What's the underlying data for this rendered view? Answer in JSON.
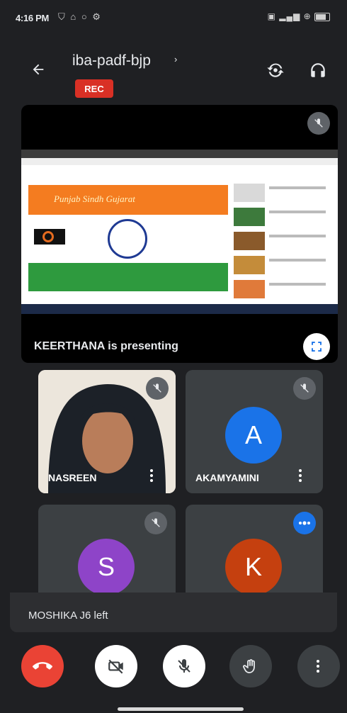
{
  "status_bar": {
    "time": "4:16 PM",
    "left_icons": "⛉ ⌂ ○ ⚙",
    "right_icons": "▣ ▂▄▆ ⊕"
  },
  "header": {
    "meeting_code": "iba-padf-bjp",
    "chevron": "›",
    "rec_badge": "REC"
  },
  "presentation": {
    "presenter_label": "KEERTHANA is presenting",
    "slide_title": "Punjab Sindh Gujarat"
  },
  "participants": [
    {
      "name": "NASREEN",
      "initial": "",
      "color": "",
      "muted": true
    },
    {
      "name": "AKAMYAMINI",
      "initial": "A",
      "color": "#1a73e8",
      "muted": true
    },
    {
      "name": "",
      "initial": "S",
      "color": "#8e44c8",
      "muted": true
    },
    {
      "name": "",
      "initial": "K",
      "color": "#c5400f",
      "muted": false
    }
  ],
  "toast": {
    "message": "MOSHIKA J6 left"
  },
  "colors": {
    "background": "#1f2023",
    "end_call": "#ea4335",
    "rec": "#d93025",
    "speaking": "#1a73e8"
  }
}
